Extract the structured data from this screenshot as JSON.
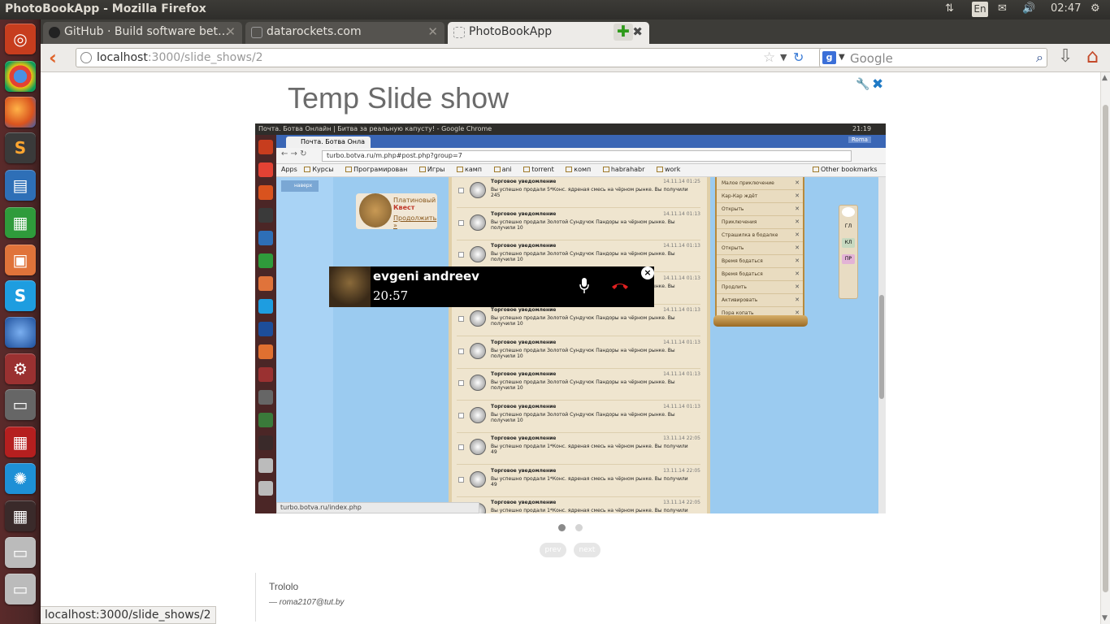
{
  "system": {
    "window_title": "PhotoBookApp - Mozilla Firefox",
    "lang": "En",
    "clock": "02:47"
  },
  "browser": {
    "tabs": [
      {
        "label": "GitHub · Build software bet…",
        "active": false
      },
      {
        "label": "datarockets.com",
        "active": false
      },
      {
        "label": "PhotoBookApp",
        "active": true
      }
    ],
    "url_host": "localhost",
    "url_path": ":3000/slide_shows/2",
    "search_engine": "Google",
    "status_url": "localhost:3000/slide_shows/2"
  },
  "page": {
    "title": "Temp Slide show",
    "pager": {
      "prev": "prev",
      "next": "next"
    },
    "caption": {
      "text": "Trololo",
      "author": "— roma2107@tut.by"
    },
    "colors": {
      "accent": "#1f7ac6"
    }
  },
  "slide": {
    "window_title": "Почта. Ботва Онлайн | Битва за реальную капусту! - Google Chrome",
    "clock": "21:19",
    "user": "Roma",
    "tab_label": "Почта. Ботва Онла",
    "url": "turbo.botva.ru/m.php#post.php?group=7",
    "bookmarks": [
      "Apps",
      "Курсы",
      "Програмирован",
      "Игры",
      "камп",
      "ani",
      "torrent",
      "комп",
      "habrahabr",
      "work"
    ],
    "other_bookmarks": "Other bookmarks",
    "nav_label": "наверх",
    "quest_title": "Платиновый",
    "quest_sub": "Квест",
    "quest_link": "Продолжить »",
    "status_link": "turbo.botva.ru/index.php",
    "feed": [
      {
        "head": "Торговое уведомление",
        "text": "Вы успешно продали 5*Конс. ядреная смесь на чёрном рынке. Вы получили 245",
        "date": "14.11.14 01:25"
      },
      {
        "head": "Торговое уведомление",
        "text": "Вы успешно продали Золотой Сундучок Пандоры на чёрном рынке. Вы получили 10",
        "date": "14.11.14 01:13"
      },
      {
        "head": "Торговое уведомление",
        "text": "Вы успешно продали Золотой Сундучок Пандоры на чёрном рынке. Вы получили 10",
        "date": "14.11.14 01:13"
      },
      {
        "head": "Торговое уведомление",
        "text": "Вы успешно продали Золотой Сундучок Пандоры на чёрном рынке. Вы получили 10",
        "date": "14.11.14 01:13"
      },
      {
        "head": "Торговое уведомление",
        "text": "Вы успешно продали Золотой Сундучок Пандоры на чёрном рынке. Вы получили 10",
        "date": "14.11.14 01:13"
      },
      {
        "head": "Торговое уведомление",
        "text": "Вы успешно продали Золотой Сундучок Пандоры на чёрном рынке. Вы получили 10",
        "date": "14.11.14 01:13"
      },
      {
        "head": "Торговое уведомление",
        "text": "Вы успешно продали Золотой Сундучок Пандоры на чёрном рынке. Вы получили 10",
        "date": "14.11.14 01:13"
      },
      {
        "head": "Торговое уведомление",
        "text": "Вы успешно продали Золотой Сундучок Пандоры на чёрном рынке. Вы получили 10",
        "date": "14.11.14 01:13"
      },
      {
        "head": "Торговое уведомление",
        "text": "Вы успешно продали 1*Конс. ядреная смесь на чёрном рынке. Вы получили 49",
        "date": "13.11.14 22:05"
      },
      {
        "head": "Торговое уведомление",
        "text": "Вы успешно продали 1*Конс. ядреная смесь на чёрном рынке. Вы получили 49",
        "date": "13.11.14 22:05"
      },
      {
        "head": "Торговое уведомление",
        "text": "Вы успешно продали 1*Конс. ядреная смесь на чёрном рынке. Вы получили 49",
        "date": "13.11.14 22:05"
      }
    ],
    "side": [
      "Малое приключение",
      "Кар-Кар ждёт",
      "Открыть",
      "Приключения",
      "Страшилка в бодалке",
      "Открыть",
      "Время бодаться",
      "Время бодаться",
      "Продлить",
      "Активировать",
      "Пора копать"
    ],
    "dock": [
      "ГЛ",
      "КЛ",
      "ПР"
    ],
    "call": {
      "name": "evgeni andreev",
      "time": "20:57"
    }
  }
}
